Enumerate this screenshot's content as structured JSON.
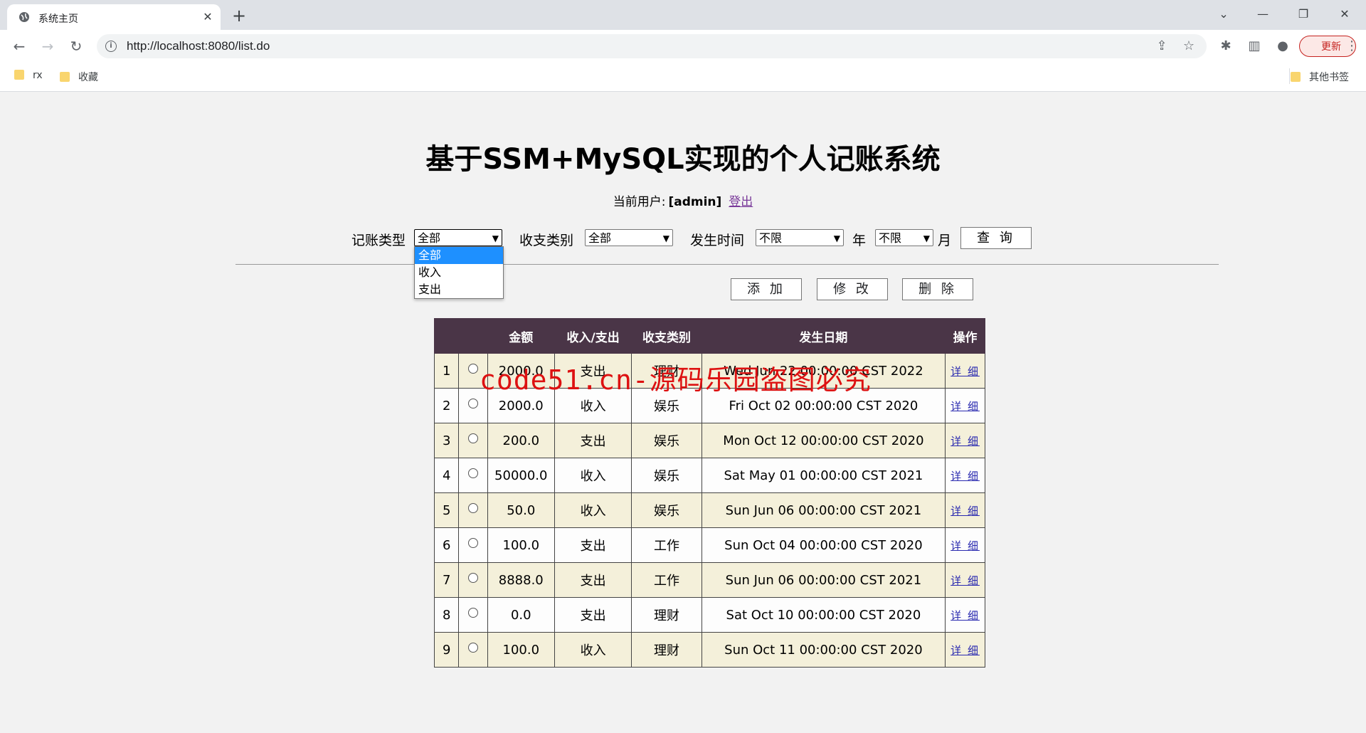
{
  "browser": {
    "tab_title": "系统主页",
    "url": "http://localhost:8080/list.do",
    "update_label": "更新",
    "bookmarks": [
      "rx",
      "收藏"
    ],
    "other_bookmarks": "其他书签"
  },
  "page": {
    "title": "基于SSM+MySQL实现的个人记账系统",
    "user_prefix": "当前用户:",
    "user_name": "[admin]",
    "logout": "登出"
  },
  "filters": {
    "type_label": "记账类型",
    "type_value": "全部",
    "type_options": [
      "全部",
      "收入",
      "支出"
    ],
    "category_label": "收支类别",
    "category_value": "全部",
    "time_label": "发生时间",
    "year_value": "不限",
    "year_suffix": "年",
    "month_value": "不限",
    "month_suffix": "月",
    "query_button": "查 询"
  },
  "actions": {
    "add": "添 加",
    "edit": "修 改",
    "delete": "删 除"
  },
  "table": {
    "headers": [
      "",
      "",
      "金额",
      "收入/支出",
      "收支类别",
      "发生日期",
      "操作"
    ],
    "detail_label": "详 细",
    "rows": [
      {
        "no": "1",
        "amount": "2000.0",
        "kind": "支出",
        "category": "理财",
        "date": "Wed Jun 22 00:00:00 CST 2022"
      },
      {
        "no": "2",
        "amount": "2000.0",
        "kind": "收入",
        "category": "娱乐",
        "date": "Fri Oct 02 00:00:00 CST 2020"
      },
      {
        "no": "3",
        "amount": "200.0",
        "kind": "支出",
        "category": "娱乐",
        "date": "Mon Oct 12 00:00:00 CST 2020"
      },
      {
        "no": "4",
        "amount": "50000.0",
        "kind": "收入",
        "category": "娱乐",
        "date": "Sat May 01 00:00:00 CST 2021"
      },
      {
        "no": "5",
        "amount": "50.0",
        "kind": "收入",
        "category": "娱乐",
        "date": "Sun Jun 06 00:00:00 CST 2021"
      },
      {
        "no": "6",
        "amount": "100.0",
        "kind": "支出",
        "category": "工作",
        "date": "Sun Oct 04 00:00:00 CST 2020"
      },
      {
        "no": "7",
        "amount": "8888.0",
        "kind": "支出",
        "category": "工作",
        "date": "Sun Jun 06 00:00:00 CST 2021"
      },
      {
        "no": "8",
        "amount": "0.0",
        "kind": "支出",
        "category": "理财",
        "date": "Sat Oct 10 00:00:00 CST 2020"
      },
      {
        "no": "9",
        "amount": "100.0",
        "kind": "收入",
        "category": "理财",
        "date": "Sun Oct 11 00:00:00 CST 2020"
      }
    ]
  },
  "watermark": "code51.cn-源码乐园盗图必究"
}
